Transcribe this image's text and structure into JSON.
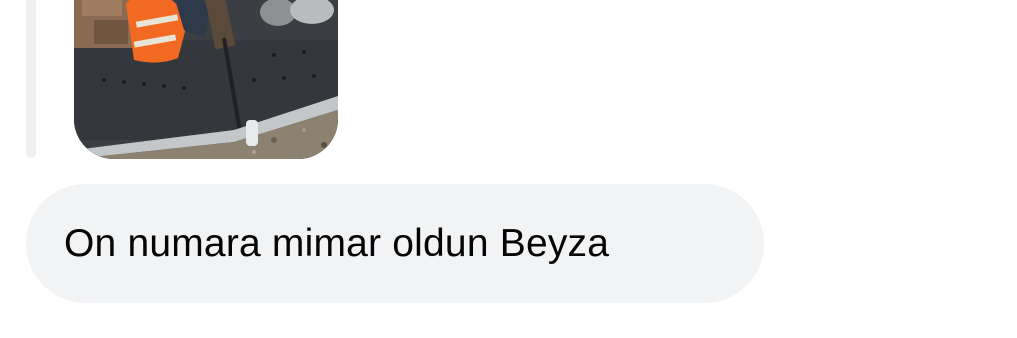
{
  "conversation": {
    "quoted_media": {
      "kind": "photo",
      "subject": "construction-site"
    },
    "message": {
      "text": "On numara mimar oldun Beyza",
      "bubble_color": "#f2f3f5",
      "text_color": "#050505"
    }
  },
  "colors": {
    "background": "#ffffff",
    "reply_bar": "#efeff1"
  }
}
